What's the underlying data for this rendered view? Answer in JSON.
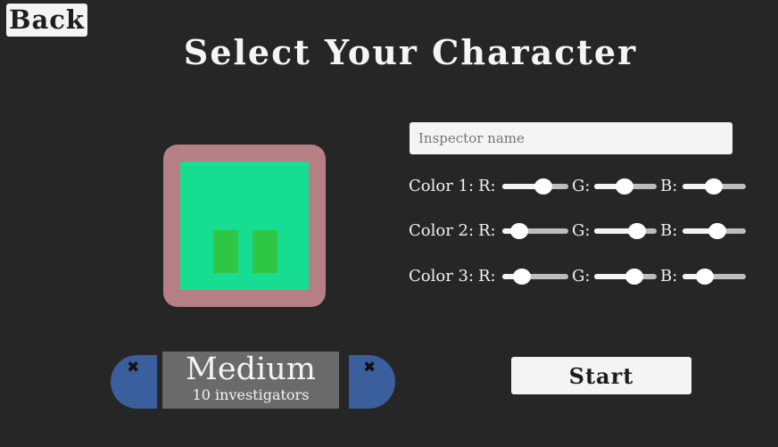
{
  "header": {
    "back_label": "Back",
    "title": "Select Your Character"
  },
  "character": {
    "outline_color": "#b57f84",
    "body_color": "#17dd92",
    "eye_color": "#2ec642"
  },
  "name_field": {
    "placeholder": "Inspector name",
    "value": ""
  },
  "colors": [
    {
      "label": "Color 1:",
      "channels": [
        {
          "label": "R:",
          "value": 0.66
        },
        {
          "label": "G:",
          "value": 0.47
        },
        {
          "label": "B:",
          "value": 0.49
        }
      ]
    },
    {
      "label": "Color 2:",
      "channels": [
        {
          "label": "R:",
          "value": 0.17
        },
        {
          "label": "G:",
          "value": 0.76
        },
        {
          "label": "B:",
          "value": 0.57
        }
      ]
    },
    {
      "label": "Color 3:",
      "channels": [
        {
          "label": "R:",
          "value": 0.23
        },
        {
          "label": "G:",
          "value": 0.69
        },
        {
          "label": "B:",
          "value": 0.3
        }
      ]
    }
  ],
  "difficulty": {
    "name": "Medium",
    "detail": "10 investigators",
    "prev_icon": "✖",
    "next_icon": "✖",
    "arrow_color": "#3a5f9c"
  },
  "start_label": "Start"
}
